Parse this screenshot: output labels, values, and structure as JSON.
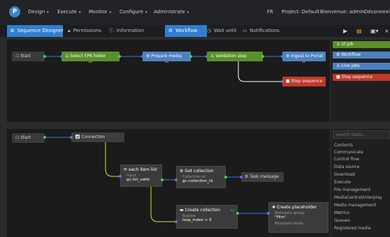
{
  "app": {
    "logo_letter": "P"
  },
  "menu": [
    {
      "label": "Design",
      "caret": "▾"
    },
    {
      "label": "Execute",
      "caret": "▾"
    },
    {
      "label": "Monitor",
      "caret": "▾"
    },
    {
      "label": "Configure",
      "caret": "▾"
    },
    {
      "label": "Administrate",
      "caret": "▾"
    }
  ],
  "header_right": {
    "lang": "FR",
    "project": "Project: Default",
    "welcome": "Bienvenue: admin",
    "disconnect": "Déconnexion"
  },
  "toolbar": {
    "designer": "Sequence Designer",
    "permissions": "Permissions",
    "information": "Information",
    "workflow": "Workflow",
    "wait_until": "Wait until",
    "notifications": "Notifications"
  },
  "top_flow": {
    "start": "Start",
    "select_epk": "Select EPK folder",
    "prepare_media": "Prepare media",
    "validation_step": "Validation step",
    "ingest": "Ingest to Portal",
    "stop": "Stop sequence"
  },
  "right_buttons": {
    "ul_job": "Ul job",
    "workflow": "Workflow",
    "live_jobs": "Live jobs",
    "stop_sequence": "Stop sequence"
  },
  "bottom_flow": {
    "start": "Start",
    "connection": "Connection",
    "each_item": {
      "title": "each item list",
      "key": "Input",
      "value": "gc.list_valid"
    },
    "get_collection": {
      "title": "Get collection",
      "key": "Collection id",
      "value": "gc.collection_id"
    },
    "task_message": "Task message",
    "create_collection": {
      "title": "Create collection",
      "key": "Bypass",
      "value": "loop_index > 0"
    },
    "create_placeholder": {
      "title": "Create placeholder",
      "key": "Metadata group",
      "value": "\"Film\"",
      "key2": "Metadata fields"
    }
  },
  "search": {
    "placeholder": "search tasks..."
  },
  "categories": [
    "Contents",
    "Communicate",
    "Control flow",
    "Data source",
    "Download",
    "Execute",
    "File management",
    "MediaCentral/Interplay",
    "Media management",
    "Metrics",
    "Queues",
    "Registered media"
  ],
  "colors": {
    "green": "#5b8f2c",
    "blue": "#4d82c0",
    "red": "#c0392b",
    "accent": "#2f7fd1",
    "connector_yellow": "#e6d93a"
  }
}
